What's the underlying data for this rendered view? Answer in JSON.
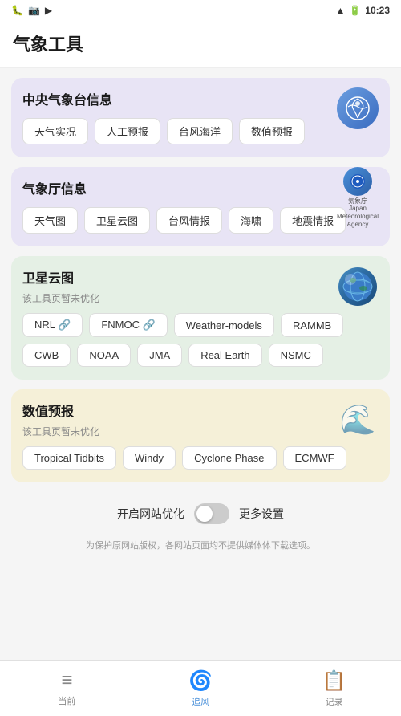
{
  "statusBar": {
    "time": "10:23",
    "icons": [
      "bug",
      "camera",
      "video",
      "wifi",
      "battery"
    ]
  },
  "header": {
    "title": "气象工具"
  },
  "sections": [
    {
      "id": "cma",
      "title": "中央气象台信息",
      "bgClass": "purple",
      "icon": "cma",
      "subtitle": null,
      "tags": [
        "天气实况",
        "人工预报",
        "台风海洋",
        "数值预报"
      ]
    },
    {
      "id": "jma",
      "title": "气象厅信息",
      "bgClass": "purple",
      "icon": "jma",
      "subtitle": null,
      "tags": [
        "天气图",
        "卫星云图",
        "台风情报",
        "海啸",
        "地震情报"
      ]
    },
    {
      "id": "satellite",
      "title": "卫星云图",
      "bgClass": "green",
      "icon": "globe",
      "subtitle": "该工具页暂未优化",
      "tags": [
        "NRL 🔗",
        "FNMOC 🔗",
        "Weather-models",
        "RAMMB",
        "CWB",
        "NOAA",
        "JMA",
        "Real Earth",
        "NSMC"
      ]
    },
    {
      "id": "numerical",
      "title": "数值预报",
      "bgClass": "yellow",
      "icon": "wave",
      "subtitle": "该工具页暂未优化",
      "tags": [
        "Tropical Tidbits",
        "Windy",
        "Cyclone Phase",
        "ECMWF"
      ]
    }
  ],
  "toggleSection": {
    "label": "开启网站优化",
    "moreLabel": "更多设置",
    "notice": "为保护原网站版权，各网站页面均不提供媒体体下载选项。"
  },
  "bottomNav": {
    "items": [
      {
        "id": "current",
        "label": "当前",
        "active": false
      },
      {
        "id": "typhoon",
        "label": "追风",
        "active": true
      },
      {
        "id": "record",
        "label": "记录",
        "active": false
      }
    ]
  }
}
